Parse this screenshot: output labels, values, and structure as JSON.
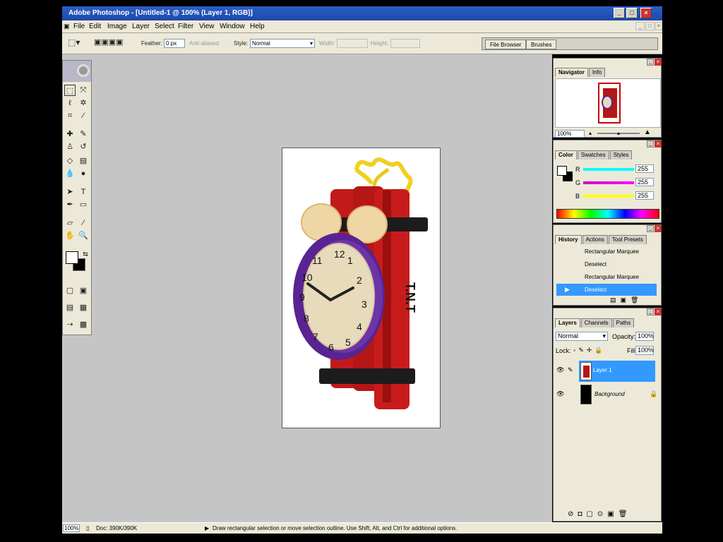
{
  "window": {
    "title": "Adobe Photoshop - [Untitled-1 @ 100% (Layer 1, RGB)]"
  },
  "menu": [
    "File",
    "Edit",
    "Image",
    "Layer",
    "Select",
    "Filter",
    "View",
    "Window",
    "Help"
  ],
  "options": {
    "feather_label": "Feather:",
    "feather_value": "0 px",
    "antialias_label": "Anti-aliased",
    "style_label": "Style:",
    "style_value": "Normal",
    "width_label": "Width:",
    "height_label": "Height:",
    "well_tabs": [
      "File Browser",
      "Brushes"
    ]
  },
  "document": {
    "title": "Untitled-1",
    "zoom": "100%",
    "clock_text": "T.N.T"
  },
  "clock_numbers": [
    "12",
    "1",
    "2",
    "3",
    "4",
    "5",
    "6",
    "7",
    "8",
    "9",
    "10",
    "11"
  ],
  "navigator": {
    "tabs": [
      "Navigator",
      "Info"
    ],
    "zoom": "100%"
  },
  "color": {
    "tabs": [
      "Color",
      "Swatches",
      "Styles"
    ],
    "channels": [
      {
        "label": "R",
        "value": "255",
        "color": "#00ffff"
      },
      {
        "label": "G",
        "value": "255",
        "color": "#cc00cc"
      },
      {
        "label": "B",
        "value": "255",
        "color": "#ffff00"
      }
    ]
  },
  "history": {
    "tabs": [
      "History",
      "Actions",
      "Tool Presets"
    ],
    "items": [
      "Rectangular Marquee",
      "Deselect",
      "Rectangular Marquee",
      "Deselect"
    ],
    "selected_index": 3
  },
  "layers": {
    "tabs": [
      "Layers",
      "Channels",
      "Paths"
    ],
    "blend_mode": "Normal",
    "opacity_label": "Opacity:",
    "opacity": "100%",
    "lock_label": "Lock:",
    "fill_label": "Fill:",
    "fill": "100%",
    "items": [
      "Layer 1",
      "Background"
    ],
    "selected_index": 0
  },
  "status": {
    "zoom": "100%",
    "doc": "Doc: 390K/390K",
    "hint": "Draw rectangular selection or move selection outline. Use Shift, Alt, and Ctrl for additional options."
  },
  "colors": {
    "accent": "#3399ff",
    "titlebar": "#1d48a8"
  }
}
